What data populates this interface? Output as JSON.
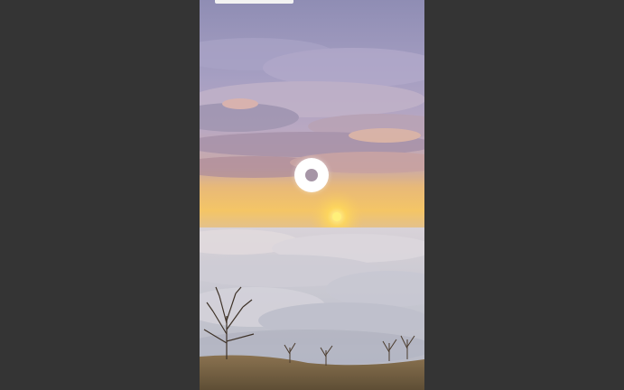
{
  "player": {
    "state": "loading",
    "background_color": "#343434",
    "progress_indicator_color": "#f2f2f2",
    "spinner_icon": "loading-spinner-icon"
  },
  "video": {
    "content_description_colors": {
      "sky_top": "#8e8ab0",
      "sky_mid": "#b79fb8",
      "horizon": "#f2c46a",
      "cloud_sea": "#cfcfd8",
      "sun": "#ffe25a",
      "ground": "#6b5a3e"
    }
  }
}
